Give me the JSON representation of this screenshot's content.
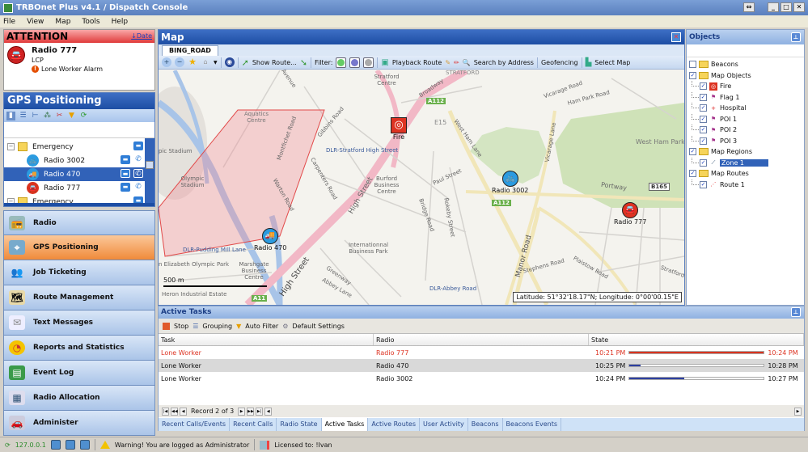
{
  "window": {
    "title": "TRBOnet Plus v4.1 / Dispatch Console",
    "buttons": [
      "restore-tile",
      "minimize",
      "maximize",
      "close"
    ]
  },
  "menu": [
    "File",
    "View",
    "Map",
    "Tools",
    "Help"
  ],
  "attention": {
    "title": "ATTENTION",
    "sort_link": "↓Date",
    "radio": "Radio 777",
    "subtitle": "LCP",
    "alarm": "Lone Worker Alarm"
  },
  "gps": {
    "title": "GPS Positioning",
    "tools": [
      "radio-view-icon",
      "list-icon",
      "tree-icon",
      "group-icon",
      "tools-icon",
      "filter-icon",
      "refresh-icon"
    ],
    "tree": [
      {
        "type": "group",
        "label": "Emergency"
      },
      {
        "type": "radio",
        "label": "Radio 3002",
        "icon": "bike",
        "color": "#2b9be0",
        "selected": false
      },
      {
        "type": "radio",
        "label": "Radio 470",
        "icon": "truck",
        "color": "#2b9be0",
        "selected": true
      },
      {
        "type": "radio",
        "label": "Radio 777",
        "icon": "car",
        "color": "#d9341f",
        "selected": false
      },
      {
        "type": "group",
        "label": "Emergency"
      }
    ]
  },
  "nav": [
    {
      "label": "Radio",
      "icon": "radio-icon",
      "active": false
    },
    {
      "label": "GPS Positioning",
      "icon": "gps-icon",
      "active": true
    },
    {
      "label": "Job Ticketing",
      "icon": "job-icon",
      "active": false
    },
    {
      "label": "Route Management",
      "icon": "route-icon",
      "active": false
    },
    {
      "label": "Text Messages",
      "icon": "envelope-icon",
      "active": false
    },
    {
      "label": "Reports and Statistics",
      "icon": "chart-icon",
      "active": false
    },
    {
      "label": "Event Log",
      "icon": "log-icon",
      "active": false
    },
    {
      "label": "Radio Allocation",
      "icon": "allocation-icon",
      "active": false
    },
    {
      "label": "Administer",
      "icon": "admin-icon",
      "active": false
    }
  ],
  "map": {
    "title": "Map",
    "tab": "BING_ROAD",
    "toolbar": {
      "show_route": "Show Route...",
      "filter": "Filter:",
      "playback": "Playback Route",
      "search": "Search by Address",
      "geofencing": "Geofencing",
      "select_map": "Select Map"
    },
    "labels": {
      "avenue": "Avenue",
      "stratford_centre": "Stratford Centre",
      "stratford": "STRATFORD",
      "broadway": "Broadway",
      "a112": "A112",
      "e15": "E15",
      "aquatics": "Aquatics Centre",
      "olympic_stadium": "Olympic Stadium",
      "pic_stadium": "pic Stadium",
      "montfichet": "Montfichet Road",
      "gibbins": "Gibbins Road",
      "dlr_stratford": "DLR-Stratford High Street",
      "burford": "Burford Business Centre",
      "carpenters": "Carpenters Road",
      "warton": "Warton Road",
      "high_street": "High Street",
      "paul_street": "Paul Street",
      "bridge_road": "Bridge Road",
      "rokeby": "Rokeby Street",
      "west_ham_lane": "West Ham Lane",
      "vicarage_road": "Vicarage Road",
      "ham_park_road": "Ham Park Road",
      "vicarage_lane": "Vicarage Lane",
      "west_ham_park": "West Ham Park",
      "portway": "Portway",
      "b165": "B165",
      "a112b": "A112",
      "dlr_pudding": "DLR-Pudding Mill Lane",
      "elizabeth": "n Elizabeth Olympic Park",
      "marshgate": "Marshgate Business Centre",
      "intl_business": "Internationnal Business Park",
      "greenway": "Greenway",
      "abbey_lane": "Abbey Lane",
      "dlr_abbey": "DLR-Abbey Road",
      "manor_road": "Manor Road",
      "heron": "Heron Industrial Estate",
      "a11": "A11",
      "stephens": "Stephens Road",
      "plaistow": "Plaistow Road",
      "stratford_r": "Stratford"
    },
    "markers": {
      "fire": "Fire",
      "radio3002": "Radio 3002",
      "radio470": "Radio 470",
      "radio777": "Radio 777"
    },
    "scale": "500 m",
    "coords": "Latitude: 51°32'18.17\"N; Longitude: 0°00'00.15\"E"
  },
  "objects": {
    "title": "Objects",
    "tree": [
      {
        "label": "Beacons",
        "level": 0,
        "checked": false,
        "icon": "folder"
      },
      {
        "label": "Map Objects",
        "level": 0,
        "checked": true,
        "icon": "folder"
      },
      {
        "label": "Fire",
        "level": 1,
        "checked": true,
        "icon": "fire"
      },
      {
        "label": "Flag 1",
        "level": 1,
        "checked": true,
        "icon": "flag"
      },
      {
        "label": "Hospital",
        "level": 1,
        "checked": true,
        "icon": "hospital"
      },
      {
        "label": "POI 1",
        "level": 1,
        "checked": true,
        "icon": "flag"
      },
      {
        "label": "POI 2",
        "level": 1,
        "checked": true,
        "icon": "flag"
      },
      {
        "label": "POI 3",
        "level": 1,
        "checked": true,
        "icon": "flag"
      },
      {
        "label": "Map Regions",
        "level": 0,
        "checked": true,
        "icon": "folder"
      },
      {
        "label": "Zone 1",
        "level": 1,
        "checked": true,
        "icon": "zone",
        "selected": true
      },
      {
        "label": "Map Routes",
        "level": 0,
        "checked": true,
        "icon": "folder"
      },
      {
        "label": "Route 1",
        "level": 1,
        "checked": true,
        "icon": "route"
      }
    ]
  },
  "tasks": {
    "title": "Active Tasks",
    "toolbar": [
      "Stop",
      "Grouping",
      "Auto Filter",
      "Default Settings"
    ],
    "columns": [
      "Task",
      "Radio",
      "State"
    ],
    "rows": [
      {
        "task": "Lone Worker",
        "radio": "Radio 777",
        "start": "10:21 PM",
        "end": "10:24 PM",
        "progress": 1.0,
        "alert": true
      },
      {
        "task": "Lone Worker",
        "radio": "Radio 470",
        "start": "10:25 PM",
        "end": "10:28 PM",
        "progress": 0.08,
        "alert": false
      },
      {
        "task": "Lone Worker",
        "radio": "Radio 3002",
        "start": "10:24 PM",
        "end": "10:27 PM",
        "progress": 0.41,
        "alert": false
      }
    ],
    "pager": "Record 2 of 3",
    "tabs": [
      "Recent Calls/Events",
      "Recent Calls",
      "Radio State",
      "Active Tasks",
      "Active Routes",
      "User Activity",
      "Beacons",
      "Beacons Events"
    ],
    "active_tab": "Active Tasks"
  },
  "status": {
    "ip": "127.0.0.1",
    "warning": "Warning! You are logged as Administrator",
    "license": "Licensed to: !Ivan"
  },
  "colors": {
    "alert_red": "#d9341f",
    "progress_blue": "#2d3fa0",
    "selection": "#3162b8",
    "active_nav": "#f08a3a"
  }
}
